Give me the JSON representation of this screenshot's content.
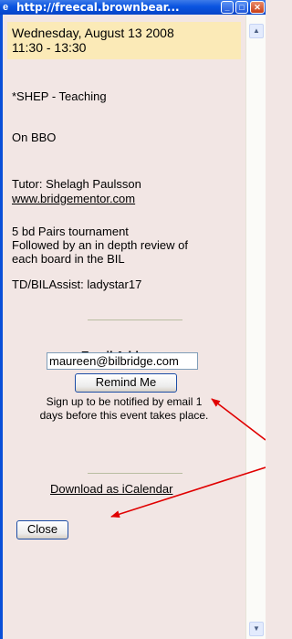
{
  "window": {
    "title": "http://freecal.brownbear..."
  },
  "event": {
    "date": "Wednesday, August 13 2008",
    "time": "11:30 - 13:30",
    "title": "*SHEP - Teaching",
    "location": "On BBO",
    "tutor": "Tutor: Shelagh Paulsson",
    "website": "www.bridgementor.com",
    "description_lines": [
      "5 bd Pairs tournament",
      "Followed by an in depth review of",
      "each board in the BIL"
    ],
    "assist": "TD/BILAssist: ladystar17"
  },
  "reminder": {
    "email_label": "Email Address:",
    "email_value": "maureen@bilbridge.com",
    "button_label": "Remind Me",
    "note_lines": [
      "Sign up to be notified by email 1",
      "days before this event takes place."
    ]
  },
  "footer": {
    "download_link": "Download as iCalendar",
    "close_label": "Close"
  },
  "icons": {
    "title": "ie-icon",
    "minimize": "minimize-icon",
    "maximize": "maximize-icon",
    "close": "close-icon"
  },
  "colors": {
    "titlebar": "#0a54e0",
    "background": "#f2e6e4",
    "date_highlight": "#fbeab7",
    "annotation_arrow": "#e00000"
  }
}
